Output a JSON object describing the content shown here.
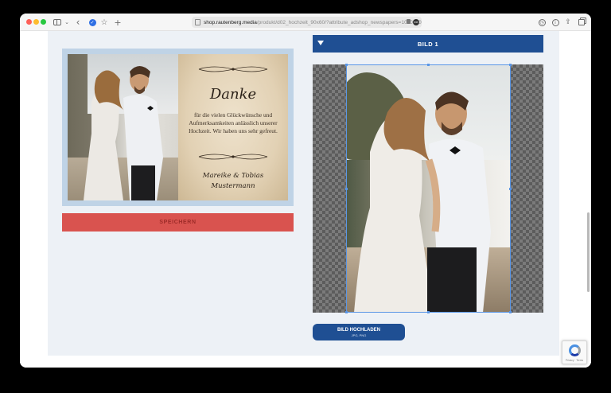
{
  "browser": {
    "url_host": "shop.rautenberg.media",
    "url_path": "/produkt/d02_hochzeit_90x60/?attribute_adshop_newspapers=1000000",
    "extension_badge": "ext",
    "icons": [
      "sidebar-icon",
      "chevron-down-icon",
      "back-icon",
      "shield-icon",
      "star-icon",
      "plus-icon",
      "clock-icon",
      "info-icon",
      "share-icon",
      "tabs-icon"
    ]
  },
  "preview": {
    "card_title": "Danke",
    "card_text": "für die vielen Glückwünsche und Aufmerksamkeiten anlässlich unserer Hochzeit. Wir haben uns sehr gefreut.",
    "card_names_line1": "Mareike & Tobias",
    "card_names_line2": "Mustermann"
  },
  "save_button": "SPEICHERN",
  "editor": {
    "header_label": "BILD 1",
    "upload_label": "BILD HOCHLADEN",
    "upload_hint": "JPG, PNG"
  },
  "recaptcha": {
    "footer": "Privacy · Terms"
  },
  "colors": {
    "accent_blue": "#1f4f93",
    "save_red": "#d9534f",
    "frame_blue": "#bfd3e6",
    "page_bg": "#edf1f6"
  }
}
